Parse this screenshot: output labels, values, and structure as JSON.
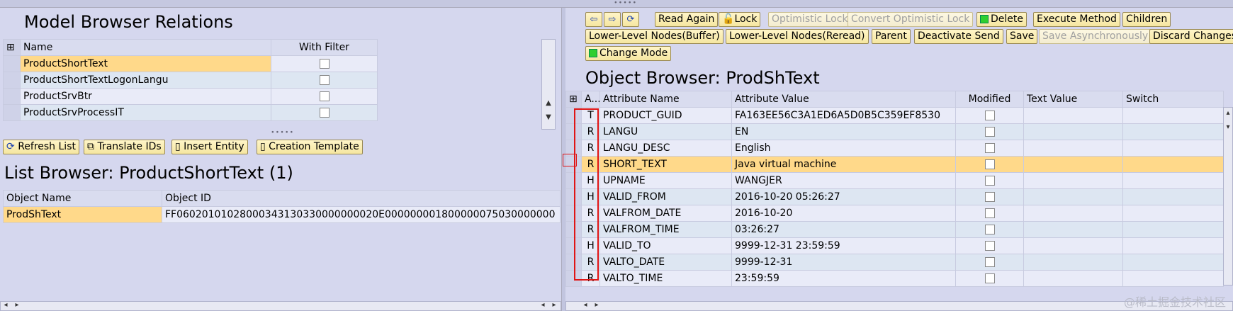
{
  "model_browser": {
    "title": "Model Browser Relations",
    "columns": [
      "Name",
      "With Filter"
    ],
    "rows": [
      {
        "name": "ProductShortText",
        "selected": true
      },
      {
        "name": "ProductShortTextLogonLangu"
      },
      {
        "name": "ProductSrvBtr"
      },
      {
        "name": "ProductSrvProcessIT"
      }
    ]
  },
  "list_toolbar": {
    "refresh": "Refresh List",
    "translate": "Translate IDs",
    "insert": "Insert Entity",
    "creation": "Creation Template"
  },
  "list_browser": {
    "title": "List Browser: ProductShortText (1)",
    "columns": [
      "Object Name",
      "Object ID"
    ],
    "rows": [
      {
        "name": "ProdShText",
        "id": "FF06020101028000343130330000000020E000000001800000075030000000"
      }
    ]
  },
  "toolbar": {
    "read_again": "Read Again",
    "lock": "Lock",
    "optimistic_lock": "Optimistic Lock",
    "convert_optimistic_lock": "Convert Optimistic Lock",
    "delete": "Delete",
    "execute_method": "Execute Method",
    "children": "Children",
    "lower_buffer": "Lower-Level Nodes(Buffer)",
    "lower_reread": "Lower-Level Nodes(Reread)",
    "parent": "Parent",
    "deactivate_send": "Deactivate Send",
    "save": "Save",
    "save_async": "Save Asynchronously",
    "discard": "Discard Changes",
    "change_mode": "Change Mode"
  },
  "object_browser": {
    "title": "Object Browser: ProdShText",
    "columns": [
      "A...",
      "Attribute Name",
      "Attribute Value",
      "Modified",
      "Text Value",
      "Switch"
    ],
    "rows": [
      {
        "a": "T",
        "name": "PRODUCT_GUID",
        "value": "FA163EE56C3A1ED6A5D0B5C359EF8530"
      },
      {
        "a": "R",
        "name": "LANGU",
        "value": "EN"
      },
      {
        "a": "R",
        "name": "LANGU_DESC",
        "value": "English"
      },
      {
        "a": "R",
        "name": "SHORT_TEXT",
        "value": "Java virtual machine",
        "selected": true
      },
      {
        "a": "H",
        "name": "UPNAME",
        "value": "WANGJER"
      },
      {
        "a": "H",
        "name": "VALID_FROM",
        "value": "2016-10-20 05:26:27"
      },
      {
        "a": "R",
        "name": "VALFROM_DATE",
        "value": "2016-10-20"
      },
      {
        "a": "R",
        "name": "VALFROM_TIME",
        "value": "03:26:27"
      },
      {
        "a": "H",
        "name": "VALID_TO",
        "value": "9999-12-31 23:59:59"
      },
      {
        "a": "R",
        "name": "VALTO_DATE",
        "value": "9999-12-31"
      },
      {
        "a": "R",
        "name": "VALTO_TIME",
        "value": "23:59:59"
      }
    ]
  },
  "watermark": "@稀土掘金技术社区",
  "colors": {
    "selected_row": "#ffd98a",
    "highlight_box": "#e01515",
    "button_bg": "#f5e6a0"
  }
}
